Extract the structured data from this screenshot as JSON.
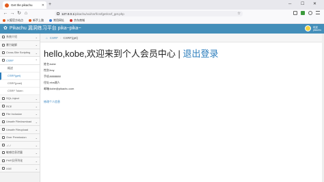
{
  "browser": {
    "tab_title": "Get the pikachu",
    "url_host": "127.0.0.1",
    "url_path": "/pikachu/vul/csrf/csrfget/csrf_get.php",
    "bookmarks": [
      "火狐官方站点",
      "新手上路",
      "常用网址",
      "京东商城"
    ]
  },
  "site": {
    "brand": "Pikachu 漏洞练习平台 pika~pika~",
    "welcome_line1": "欢迎",
    "welcome_line2": "pikachu"
  },
  "sidebar": {
    "items": [
      {
        "label": "系统介绍",
        "expanded": false
      },
      {
        "label": "暴力破解",
        "expanded": false
      },
      {
        "label": "Cross-Site Scripting",
        "expanded": false
      },
      {
        "label": "CSRF",
        "expanded": true,
        "sub": [
          {
            "label": "概述",
            "active": false
          },
          {
            "label": "CSRF(get)",
            "active": true
          },
          {
            "label": "CSRF(post)",
            "active": false
          },
          {
            "label": "CSRF Token",
            "active": false
          }
        ]
      },
      {
        "label": "SQL-Inject",
        "expanded": false
      },
      {
        "label": "RCE",
        "expanded": false
      },
      {
        "label": "File Inclusion",
        "expanded": false
      },
      {
        "label": "Unsafe Filedownload",
        "expanded": false
      },
      {
        "label": "Unsafe Fileupload",
        "expanded": false
      },
      {
        "label": "Over Permission",
        "expanded": false
      },
      {
        "label": "../../",
        "expanded": false
      },
      {
        "label": "敏感信息泄露",
        "expanded": false
      },
      {
        "label": "PHP反序列化",
        "expanded": false
      },
      {
        "label": "XXE",
        "expanded": false
      }
    ]
  },
  "breadcrumb": {
    "home": "CSRF",
    "current": "CSRF(get)"
  },
  "main": {
    "greeting": "hello,kobe,欢迎来到个人会员中心",
    "separator": "|",
    "logout": "退出登录",
    "fields": [
      "姓名:kobe",
      "性别:boy",
      "手机:8888888",
      "住址:nba湖人",
      "邮箱:kobe@pikachu.com"
    ],
    "edit_link": "修改个人信息"
  },
  "colors": {
    "header_bg": "#438eb9",
    "link": "#2b7dbc"
  }
}
